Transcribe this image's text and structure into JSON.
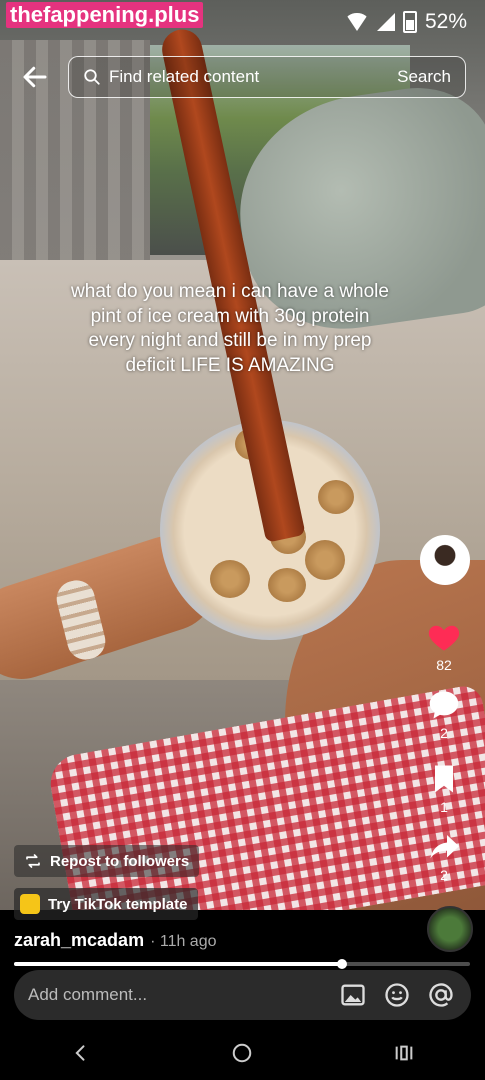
{
  "watermark": "thefappening.plus",
  "status": {
    "battery": "52%"
  },
  "search": {
    "placeholder": "Find related content",
    "button": "Search"
  },
  "caption": "what do you mean i can have a whole pint of ice cream with 30g protein every night and still be in my prep deficit LIFE IS AMAZING",
  "actions": {
    "likes": "82",
    "comments": "2",
    "saves": "1",
    "shares": "2"
  },
  "repost_label": "Repost to followers",
  "template_label": "Try TikTok template",
  "author": {
    "username": "zarah_mcadam",
    "time": "· 11h ago"
  },
  "playback_progress": 0.72,
  "comment": {
    "placeholder": "Add comment..."
  },
  "colors": {
    "like": "#fe2c55",
    "template_icon": "#f5c518"
  }
}
